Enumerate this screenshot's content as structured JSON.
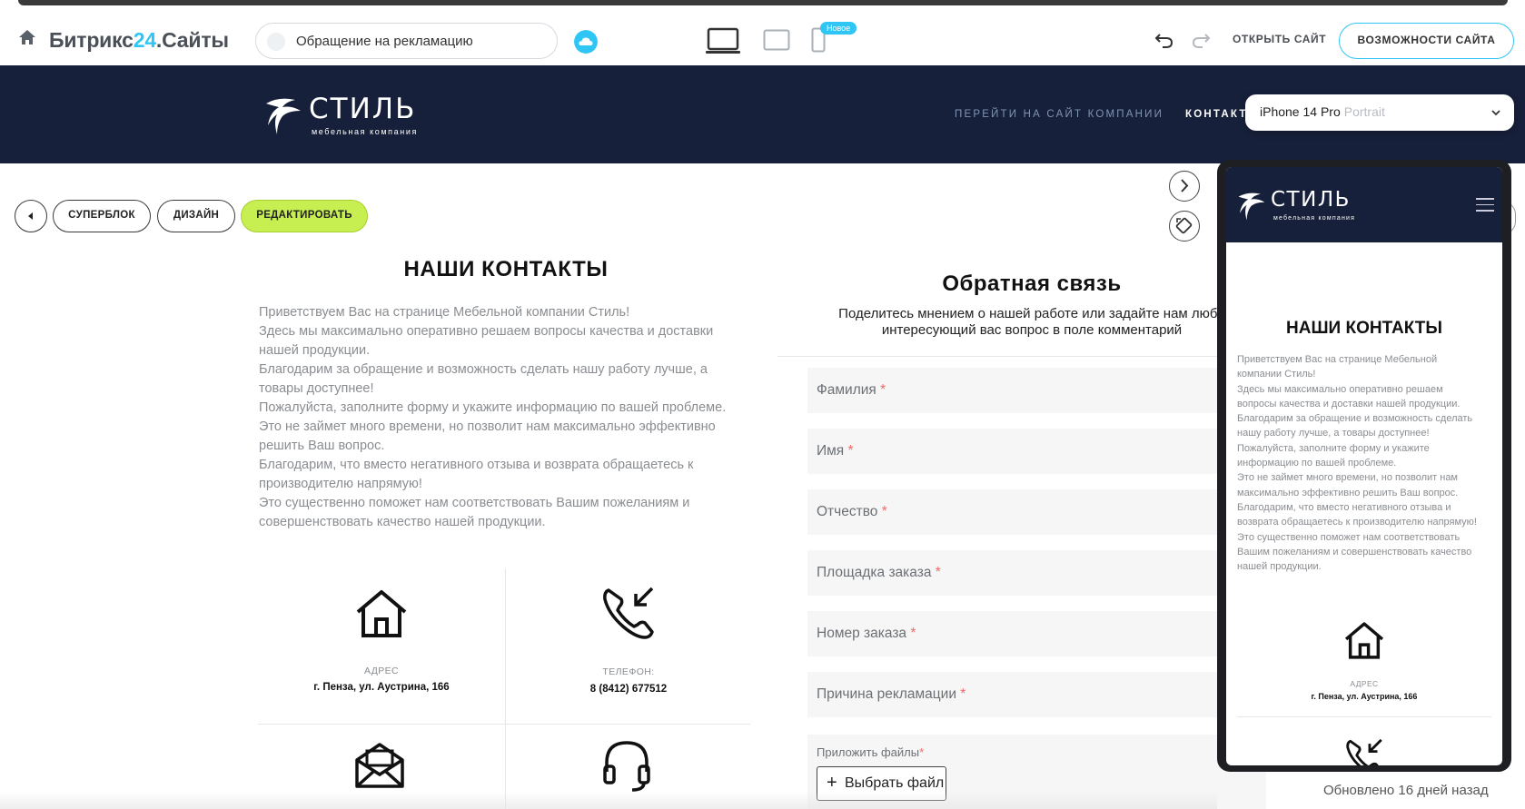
{
  "toolbar": {
    "brand_prefix": "Битрикс",
    "brand_number": "24",
    "brand_suffix": ".Сайты",
    "page_name": "Обращение на рекламацию",
    "new_badge": "Новое",
    "open_site": "ОТКРЫТЬ САЙТ",
    "site_features": "ВОЗМОЖНОСТИ САЙТА",
    "accent_color": "#2fc6f6"
  },
  "site_header": {
    "logo_word": "СТИЛЬ",
    "logo_sub": "мебельная компания",
    "nav": [
      "ПЕРЕЙТИ НА САЙТ КОМПАНИИ",
      "КОНТАКТ"
    ],
    "background": "#17203a"
  },
  "device_select": {
    "device": "iPhone 14 Pro",
    "orientation": "Portrait"
  },
  "block_controls": {
    "superblock": "СУПЕРБЛОК",
    "design": "ДИЗАЙН",
    "edit": "РЕДАКТИРОВАТЬ",
    "edit_color": "#c7ef51"
  },
  "contacts": {
    "title": "НАШИ КОНТАКТЫ",
    "intro": [
      "Приветствуем Вас на странице Мебельной компании Стиль!",
      "Здесь мы максимально оперативно решаем вопросы качества и доставки",
      "нашей продукции.",
      "Благодарим за обращение и возможность сделать нашу работу лучше, а",
      "товары доступнее!",
      "Пожалуйста, заполните форму и укажите информацию по вашей проблеме.",
      "Это не займет много времени, но позволит нам максимально эффективно",
      "решить Ваш вопрос.",
      "Благодарим, что вместо негативного отзыва и возврата обращаетесь к",
      "производителю напрямую!",
      "Это существенно поможет нам соответствовать Вашим пожеланиям и",
      "совершенствовать качество нашей продукции."
    ],
    "address_label": "АДРЕС",
    "address_value": "г. Пенза, ул. Аустрина, 166",
    "phone_label": "ТЕЛЕФОН:",
    "phone_value": "8 (8412) 677512"
  },
  "form": {
    "title": "Обратная связь",
    "subtitle_line1": "Поделитесь мнением о нашей работе или задайте нам любо",
    "subtitle_line2": "интересующий вас вопрос в поле комментарий",
    "fields": [
      "Фамилия",
      "Имя",
      "Отчество",
      "Площадка заказа",
      "Номер заказа",
      "Причина рекламации"
    ],
    "required_mark": "*",
    "files_label": "Приложить файлы",
    "file_button": "Выбрать файл",
    "plus": "+"
  },
  "phone_preview": {
    "title": "НАШИ КОНТАКТЫ",
    "intro": [
      "Приветствуем Вас на странице Мебельной",
      "компании Стиль!",
      "Здесь мы максимально оперативно решаем",
      "вопросы качества и доставки нашей продукции.",
      "Благодарим за обращение и возможность сделать",
      "нашу работу лучше, а товары доступнее!",
      "Пожалуйста, заполните форму и укажите",
      "информацию по вашей проблеме.",
      "Это не займет много времени, но позволит нам",
      "максимально эффективно решить Ваш вопрос.",
      "Благодарим, что вместо негативного отзыва и",
      "возврата обращаетесь к производителю напрямую!",
      "Это существенно поможет нам соответствовать",
      "Вашим пожеланиям и совершенствовать качество",
      "нашей продукции."
    ],
    "address_label": "АДРЕС",
    "address_value": "г. Пенза, ул. Аустрина, 166"
  },
  "status": {
    "updated": "Обновлено 16 дней назад"
  }
}
